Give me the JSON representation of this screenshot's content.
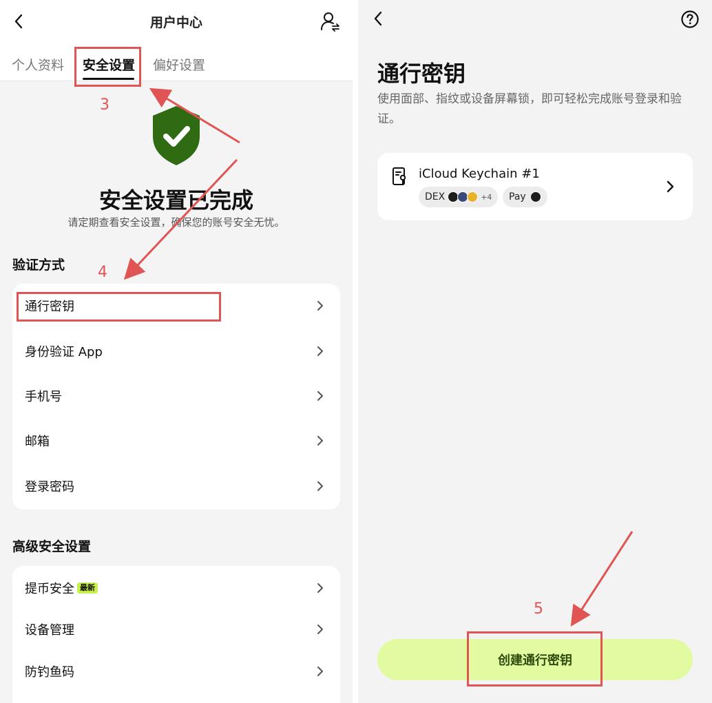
{
  "left": {
    "header": {
      "title": "用户中心"
    },
    "tabs": [
      {
        "label": "个人资料",
        "active": false
      },
      {
        "label": "安全设置",
        "active": true
      },
      {
        "label": "偏好设置",
        "active": false
      }
    ],
    "hero": {
      "title": "安全设置已完成",
      "subtitle": "请定期查看安全设置，确保您的账号安全无忧。"
    },
    "verification": {
      "title": "验证方式",
      "items": [
        "通行密钥",
        "身份验证 App",
        "手机号",
        "邮箱",
        "登录密码"
      ]
    },
    "advanced": {
      "title": "高级安全设置",
      "items": [
        "提币安全",
        "设备管理",
        "防钓鱼码"
      ],
      "new_badge": "最新"
    }
  },
  "right": {
    "title": "通行密钥",
    "description": "使用面部、指纹或设备屏幕锁，即可轻松完成账号登录和验证。",
    "key_card": {
      "name": "iCloud Keychain #1",
      "chip_dex": "DEX",
      "chip_more": "+4",
      "chip_pay": "Pay"
    },
    "create_button": "创建通行密钥"
  },
  "annotations": {
    "step3": "3",
    "step4": "4",
    "step5": "5"
  },
  "colors": {
    "accent_lime": "#c8f04a",
    "button_bg": "#e3fba0",
    "shield_green": "#2f6b12",
    "annotation_red": "#e05454"
  },
  "icons": [
    "back-arrow-icon",
    "user-switch-icon",
    "shield-check-icon",
    "chevron-right-icon",
    "help-icon",
    "key-device-icon"
  ]
}
